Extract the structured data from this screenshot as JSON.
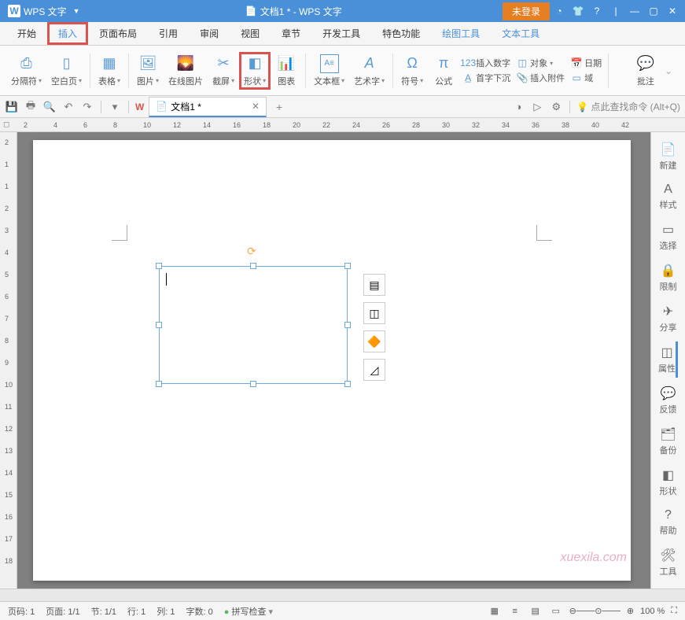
{
  "titlebar": {
    "app_name": "WPS 文字",
    "doc_title": "文档1 * - WPS 文字",
    "login": "未登录"
  },
  "menubar": {
    "tabs": [
      "开始",
      "插入",
      "页面布局",
      "引用",
      "审阅",
      "视图",
      "章节",
      "开发工具",
      "特色功能",
      "绘图工具",
      "文本工具"
    ]
  },
  "ribbon": {
    "items": [
      "分隔符",
      "空白页",
      "表格",
      "图片",
      "在线图片",
      "截屏",
      "形状",
      "图表",
      "文本框",
      "艺术字",
      "符号",
      "公式"
    ],
    "small": {
      "insert_number": "插入数字",
      "first_line": "首字下沉",
      "object": "对象",
      "attach": "插入附件",
      "date": "日期",
      "field": "域"
    },
    "end": "批注"
  },
  "qat": {
    "doc_tab": "文档1 *",
    "search_hint": "点此查找命令 (Alt+Q)"
  },
  "sidebar": {
    "items": [
      "新建",
      "样式",
      "选择",
      "限制",
      "分享",
      "属性",
      "反馈",
      "备份",
      "形状",
      "帮助",
      "工具"
    ]
  },
  "statusbar": {
    "page": "页码: 1",
    "page_num": "页面: 1/1",
    "section": "节: 1/1",
    "line": "行: 1",
    "col": "列: 1",
    "words": "字数: 0",
    "spell": "拼写检查",
    "zoom": "100 %"
  },
  "ruler_h": [
    2,
    4,
    6,
    8,
    10,
    12,
    14,
    16,
    18,
    20,
    22,
    24,
    26,
    28,
    30,
    32,
    34,
    36,
    38,
    40,
    42
  ],
  "ruler_v": [
    2,
    1,
    1,
    2,
    3,
    4,
    5,
    6,
    7,
    8,
    9,
    10,
    11,
    12,
    13,
    14,
    15,
    16,
    17,
    18
  ],
  "watermark": "xuexila.com"
}
